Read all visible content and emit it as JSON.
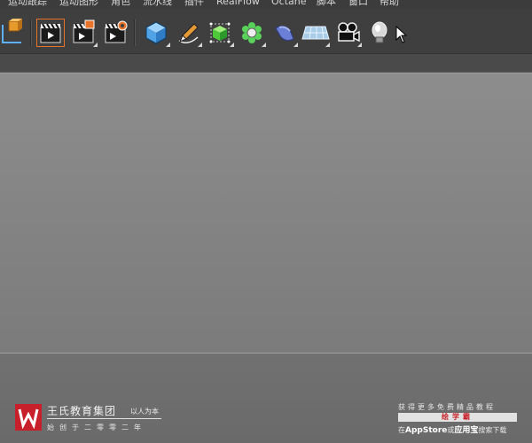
{
  "menu": {
    "items": [
      "运动跟踪",
      "运动图形",
      "角色",
      "流水线",
      "插件",
      "RealFlow",
      "Octane",
      "脚本",
      "窗口",
      "帮助"
    ]
  },
  "toolbar": {
    "left_icons": [
      "coordinate-axes-icon",
      "render-view-icon",
      "render-picture-viewer-icon",
      "render-settings-icon"
    ],
    "right_icons": [
      "cube-icon",
      "pen-spline-icon",
      "subdivision-surface-icon",
      "cloner-flower-icon",
      "deformer-bend-icon",
      "floor-plane-icon",
      "camera-icon",
      "light-bulb-icon"
    ]
  },
  "watermark": {
    "brand": "王氏教育集团",
    "tagline": "以人为本",
    "founded": "始创于二零零二年",
    "brand_color": "#c8202a"
  },
  "promo": {
    "line1": "获得更多免费精品教程",
    "highlight": "绘学霸",
    "line3_prefix": "在",
    "store1": "AppStore",
    "line3_mid": "或",
    "store2": "应用宝",
    "line3_suffix": "搜索下载"
  }
}
